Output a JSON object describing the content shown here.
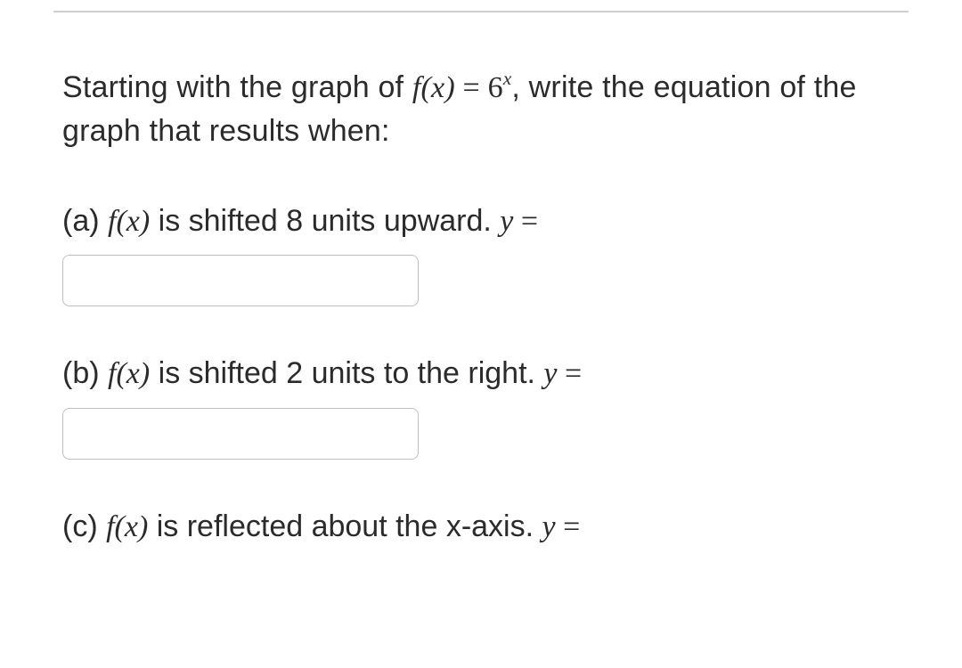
{
  "intro": {
    "pre": "Starting with the graph of ",
    "func": "f(x)",
    "eq_left": " = ",
    "base": "6",
    "exp": "x",
    "post": ", write the equation of the graph that results when:"
  },
  "parts": {
    "a": {
      "label": "(a) ",
      "func": "f(x)",
      "desc": " is shifted 8 units upward. ",
      "yvar": "y",
      "eq": " =",
      "value": ""
    },
    "b": {
      "label": "(b) ",
      "func": "f(x)",
      "desc": " is shifted 2 units to the right. ",
      "yvar": "y",
      "eq": " =",
      "value": ""
    },
    "c": {
      "label": "(c) ",
      "func": "f(x)",
      "desc": " is reflected about the x-axis. ",
      "yvar": "y",
      "eq": " =",
      "value": ""
    }
  }
}
